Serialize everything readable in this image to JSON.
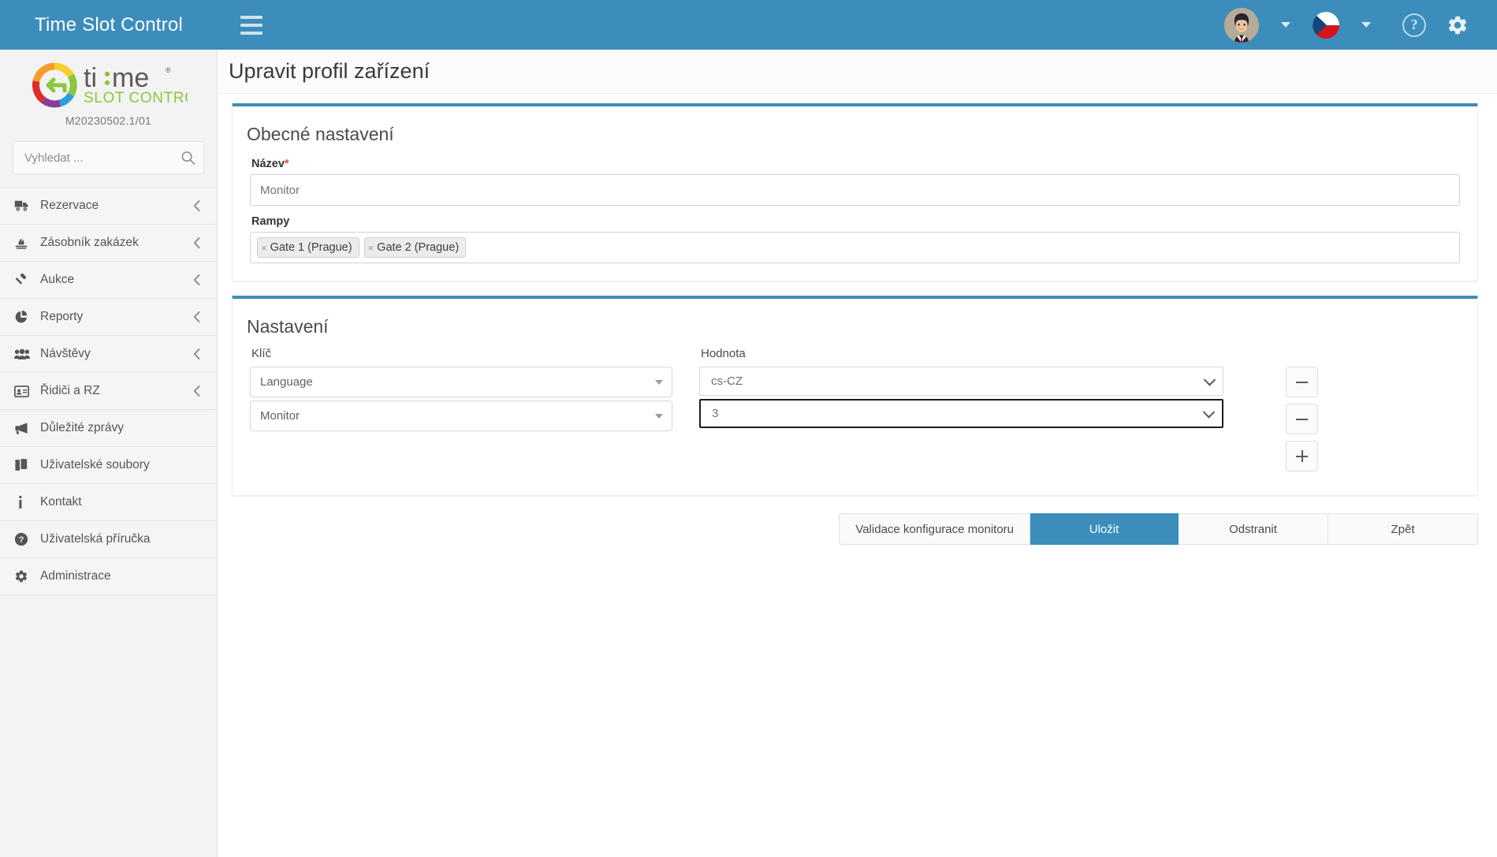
{
  "topbar": {
    "brand_title": "Time Slot Control",
    "menu_toggle_label": "Menu",
    "user_caret_label": "",
    "lang_caret_label": "",
    "help_label": "?",
    "settings_label": ""
  },
  "sidebar": {
    "logo_text_primary": "ti:me",
    "logo_text_secondary": "SLOT CONTROL",
    "version": "M20230502.1/01",
    "search": {
      "placeholder": "Vyhledat ...",
      "value": ""
    },
    "items": [
      {
        "label": "Rezervace",
        "icon": "truck-icon",
        "chevron": true
      },
      {
        "label": "Zásobník zakázek",
        "icon": "stack-icon",
        "chevron": true
      },
      {
        "label": "Aukce",
        "icon": "gavel-icon",
        "chevron": true
      },
      {
        "label": "Reporty",
        "icon": "pie-chart-icon",
        "chevron": true
      },
      {
        "label": "Návštěvy",
        "icon": "users-icon",
        "chevron": true
      },
      {
        "label": "Řidiči a RZ",
        "icon": "id-card-icon",
        "chevron": true
      },
      {
        "label": "Důležité zprávy",
        "icon": "megaphone-icon",
        "chevron": false
      },
      {
        "label": "Uživatelské soubory",
        "icon": "copy-files-icon",
        "chevron": false
      },
      {
        "label": "Kontakt",
        "icon": "info-icon",
        "chevron": false
      },
      {
        "label": "Uživatelská příručka",
        "icon": "question-circle-icon",
        "chevron": false
      },
      {
        "label": "Administrace",
        "icon": "cog-icon",
        "chevron": false
      }
    ]
  },
  "page": {
    "title": "Upravit profil zařízení"
  },
  "general_card": {
    "title": "Obecné nastavení",
    "name_label": "Název",
    "name_required_marker": "*",
    "name_value": "Monitor",
    "ramps_label": "Rampy",
    "ramps_tags": [
      {
        "remove_glyph": "×",
        "label": "Gate 1 (Prague)"
      },
      {
        "remove_glyph": "×",
        "label": "Gate 2 (Prague)"
      }
    ]
  },
  "settings_card": {
    "title": "Nastavení",
    "key_column_header": "Klíč",
    "value_column_header": "Hodnota",
    "rows": [
      {
        "key": "Language",
        "value": "cs-CZ",
        "value_focused": false,
        "remove_label": "−"
      },
      {
        "key": "Monitor",
        "value": "3",
        "value_focused": true,
        "remove_label": "−"
      }
    ],
    "add_label": "+"
  },
  "actions": {
    "validate_label": "Validace konfigurace monitoru",
    "save_label": "Uložit",
    "delete_label": "Odstranit",
    "back_label": "Zpět"
  },
  "colors": {
    "accent": "#3c8dbc",
    "sidebar_bg": "#f3f3f3",
    "required_marker": "#dd4b39",
    "logo_green": "#8cc63e",
    "logo_gray": "#58595b"
  }
}
